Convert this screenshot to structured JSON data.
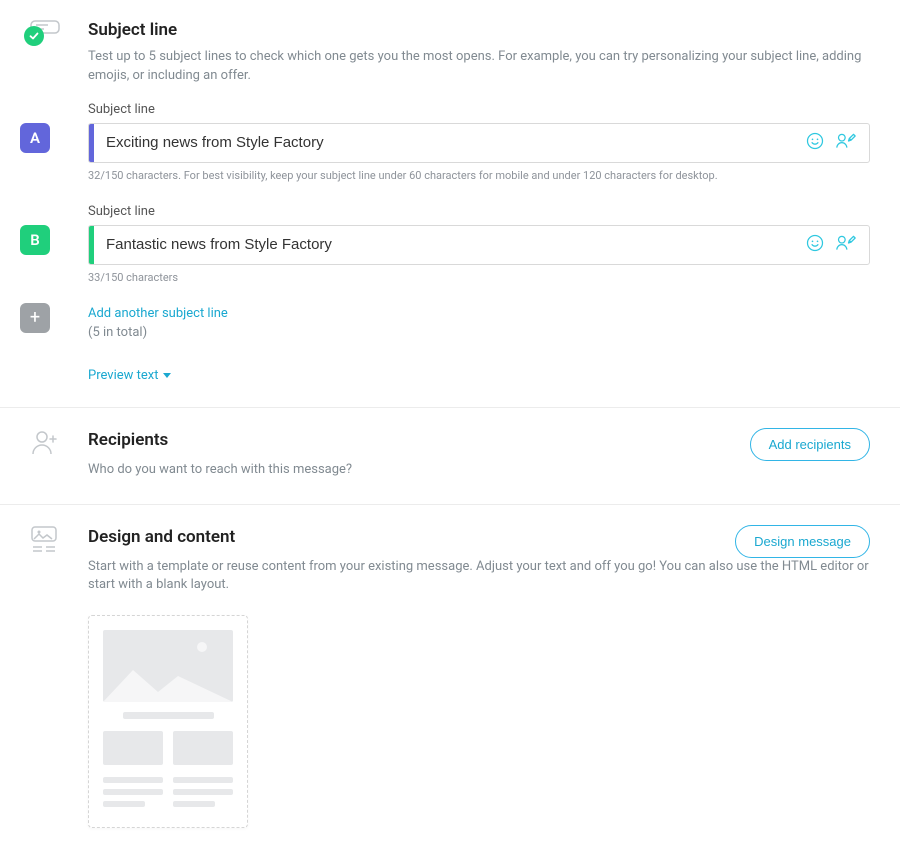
{
  "subject": {
    "title": "Subject line",
    "desc": "Test up to 5 subject lines to check which one gets you the most opens. For example, you can try personalizing your subject line, adding emojis, or including an offer.",
    "field_label": "Subject line",
    "variant_a": {
      "letter": "A",
      "value": "Exciting news from Style Factory",
      "helper": "32/150 characters. For best visibility, keep your subject line under 60 characters for mobile and under 120 characters for desktop."
    },
    "variant_b": {
      "letter": "B",
      "value": "Fantastic news from Style Factory",
      "helper": "33/150 characters"
    },
    "add_link": "Add another subject line",
    "add_sub": "(5 in total)",
    "preview_link": "Preview text"
  },
  "recipients": {
    "title": "Recipients",
    "desc": "Who do you want to reach with this message?",
    "button": "Add recipients"
  },
  "design": {
    "title": "Design and content",
    "desc": "Start with a template or reuse content from your existing message. Adjust your text and off you go! You can also use the HTML editor or start with a blank layout.",
    "button": "Design message"
  }
}
